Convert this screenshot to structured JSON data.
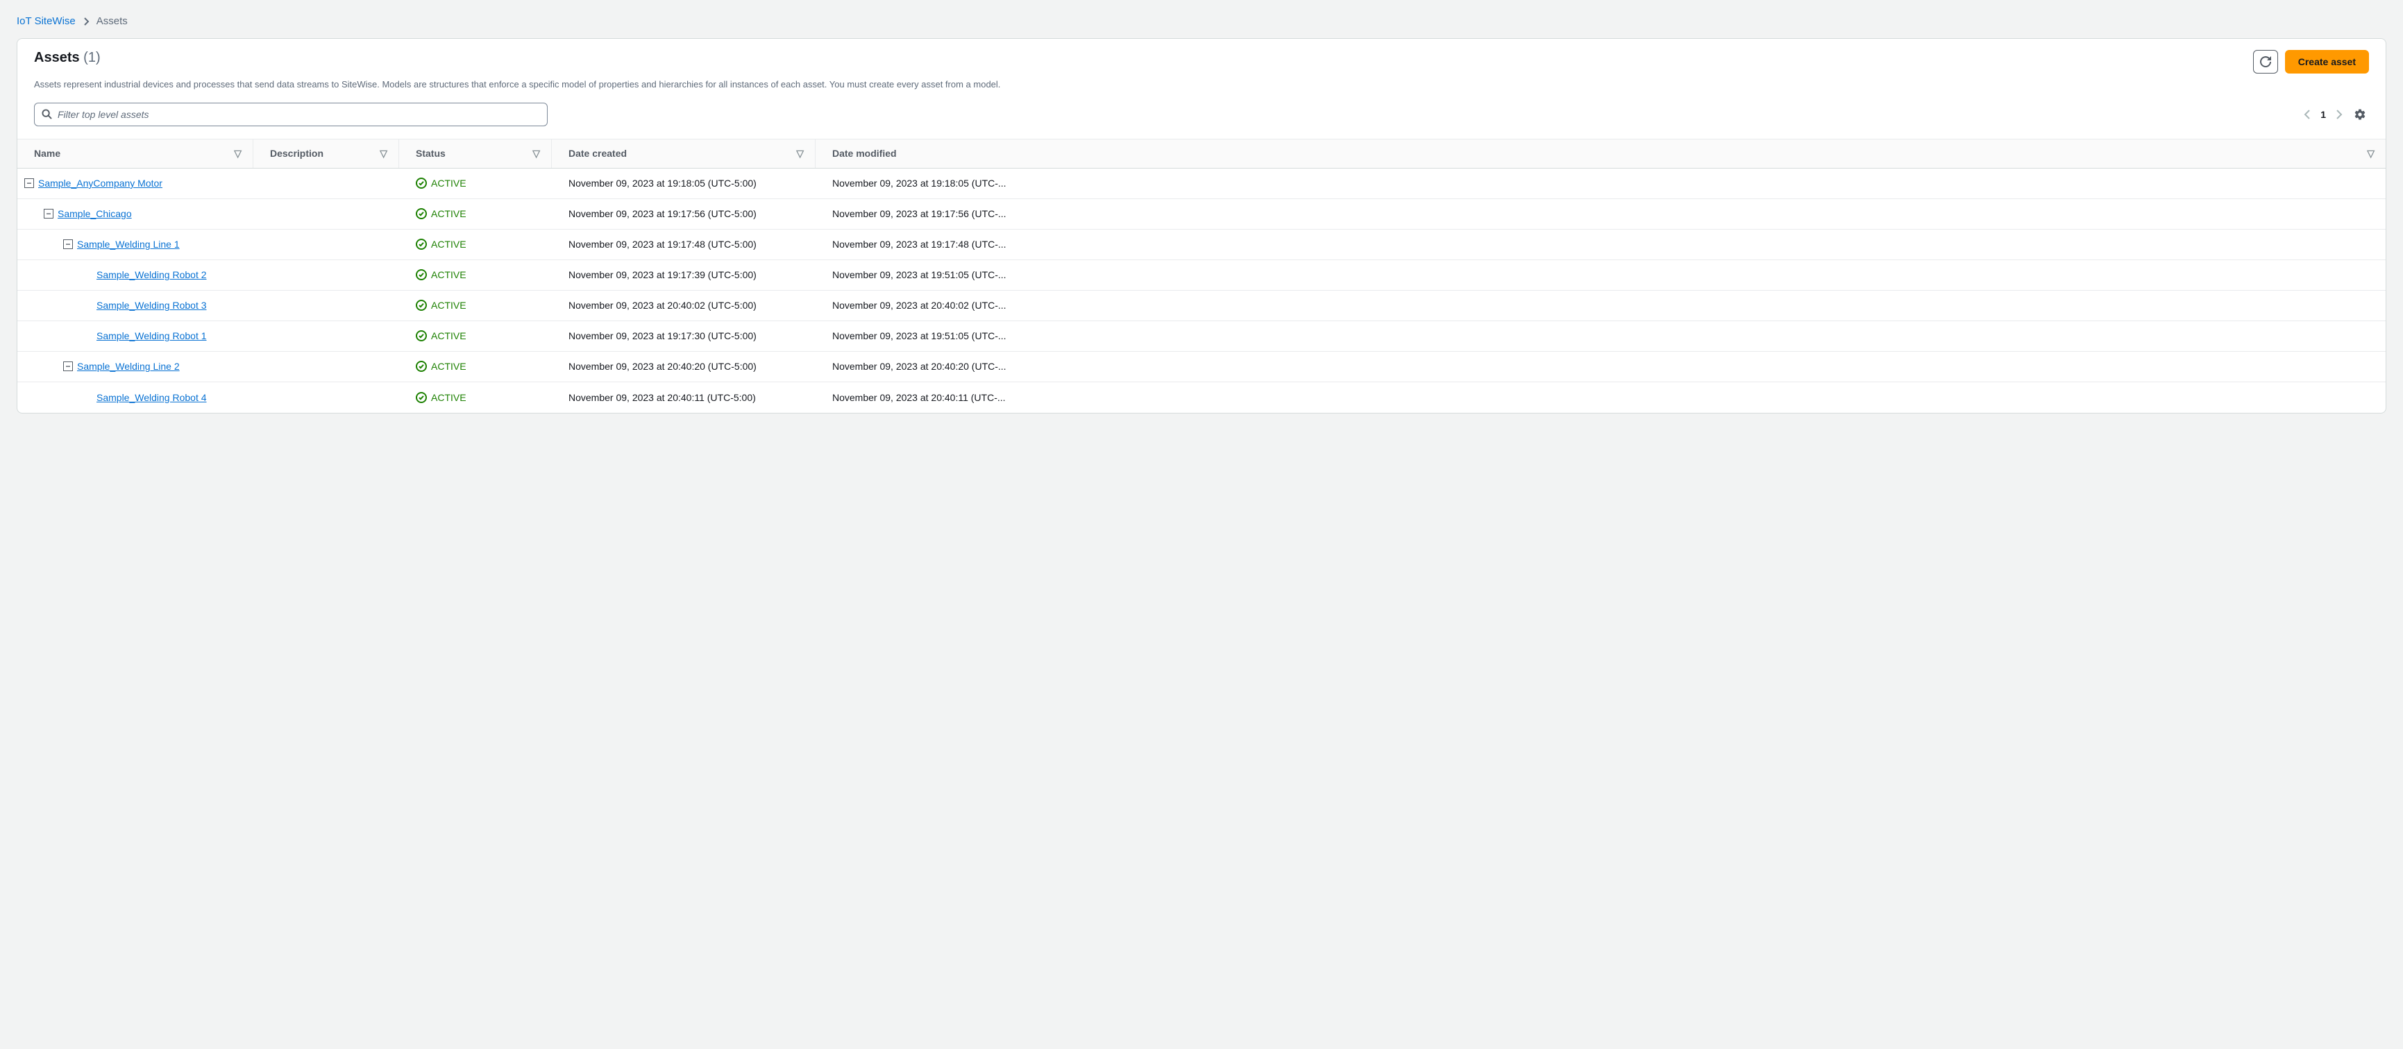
{
  "breadcrumb": {
    "root": "IoT SiteWise",
    "current": "Assets"
  },
  "header": {
    "title": "Assets",
    "count": "(1)",
    "description": "Assets represent industrial devices and processes that send data streams to SiteWise. Models are structures that enforce a specific model of properties and hierarchies for all instances of each asset. You must create every asset from a model.",
    "refresh_label": "Refresh",
    "create_label": "Create asset"
  },
  "search": {
    "placeholder": "Filter top level assets"
  },
  "pager": {
    "page": "1"
  },
  "columns": {
    "name": "Name",
    "description": "Description",
    "status": "Status",
    "created": "Date created",
    "modified": "Date modified"
  },
  "status_active": "ACTIVE",
  "rows": [
    {
      "indent": 0,
      "expand": "minus",
      "name": "Sample_AnyCompany Motor",
      "desc": "",
      "status": "ACTIVE",
      "created": "November 09, 2023 at 19:18:05 (UTC-5:00)",
      "modified": "November 09, 2023 at 19:18:05 (UTC-..."
    },
    {
      "indent": 1,
      "expand": "minus",
      "name": "Sample_Chicago",
      "desc": "",
      "status": "ACTIVE",
      "created": "November 09, 2023 at 19:17:56 (UTC-5:00)",
      "modified": "November 09, 2023 at 19:17:56 (UTC-..."
    },
    {
      "indent": 2,
      "expand": "minus",
      "name": "Sample_Welding Line 1",
      "desc": "",
      "status": "ACTIVE",
      "created": "November 09, 2023 at 19:17:48 (UTC-5:00)",
      "modified": "November 09, 2023 at 19:17:48 (UTC-..."
    },
    {
      "indent": 3,
      "expand": "none",
      "name": "Sample_Welding Robot 2",
      "desc": "",
      "status": "ACTIVE",
      "created": "November 09, 2023 at 19:17:39 (UTC-5:00)",
      "modified": "November 09, 2023 at 19:51:05 (UTC-..."
    },
    {
      "indent": 3,
      "expand": "none",
      "name": "Sample_Welding Robot 3",
      "desc": "",
      "status": "ACTIVE",
      "created": "November 09, 2023 at 20:40:02 (UTC-5:00)",
      "modified": "November 09, 2023 at 20:40:02 (UTC-..."
    },
    {
      "indent": 3,
      "expand": "none",
      "name": "Sample_Welding Robot 1",
      "desc": "",
      "status": "ACTIVE",
      "created": "November 09, 2023 at 19:17:30 (UTC-5:00)",
      "modified": "November 09, 2023 at 19:51:05 (UTC-..."
    },
    {
      "indent": 2,
      "expand": "minus",
      "name": "Sample_Welding Line 2",
      "desc": "",
      "status": "ACTIVE",
      "created": "November 09, 2023 at 20:40:20 (UTC-5:00)",
      "modified": "November 09, 2023 at 20:40:20 (UTC-..."
    },
    {
      "indent": 3,
      "expand": "none",
      "name": "Sample_Welding Robot 4",
      "desc": "",
      "status": "ACTIVE",
      "created": "November 09, 2023 at 20:40:11 (UTC-5:00)",
      "modified": "November 09, 2023 at 20:40:11 (UTC-..."
    }
  ]
}
